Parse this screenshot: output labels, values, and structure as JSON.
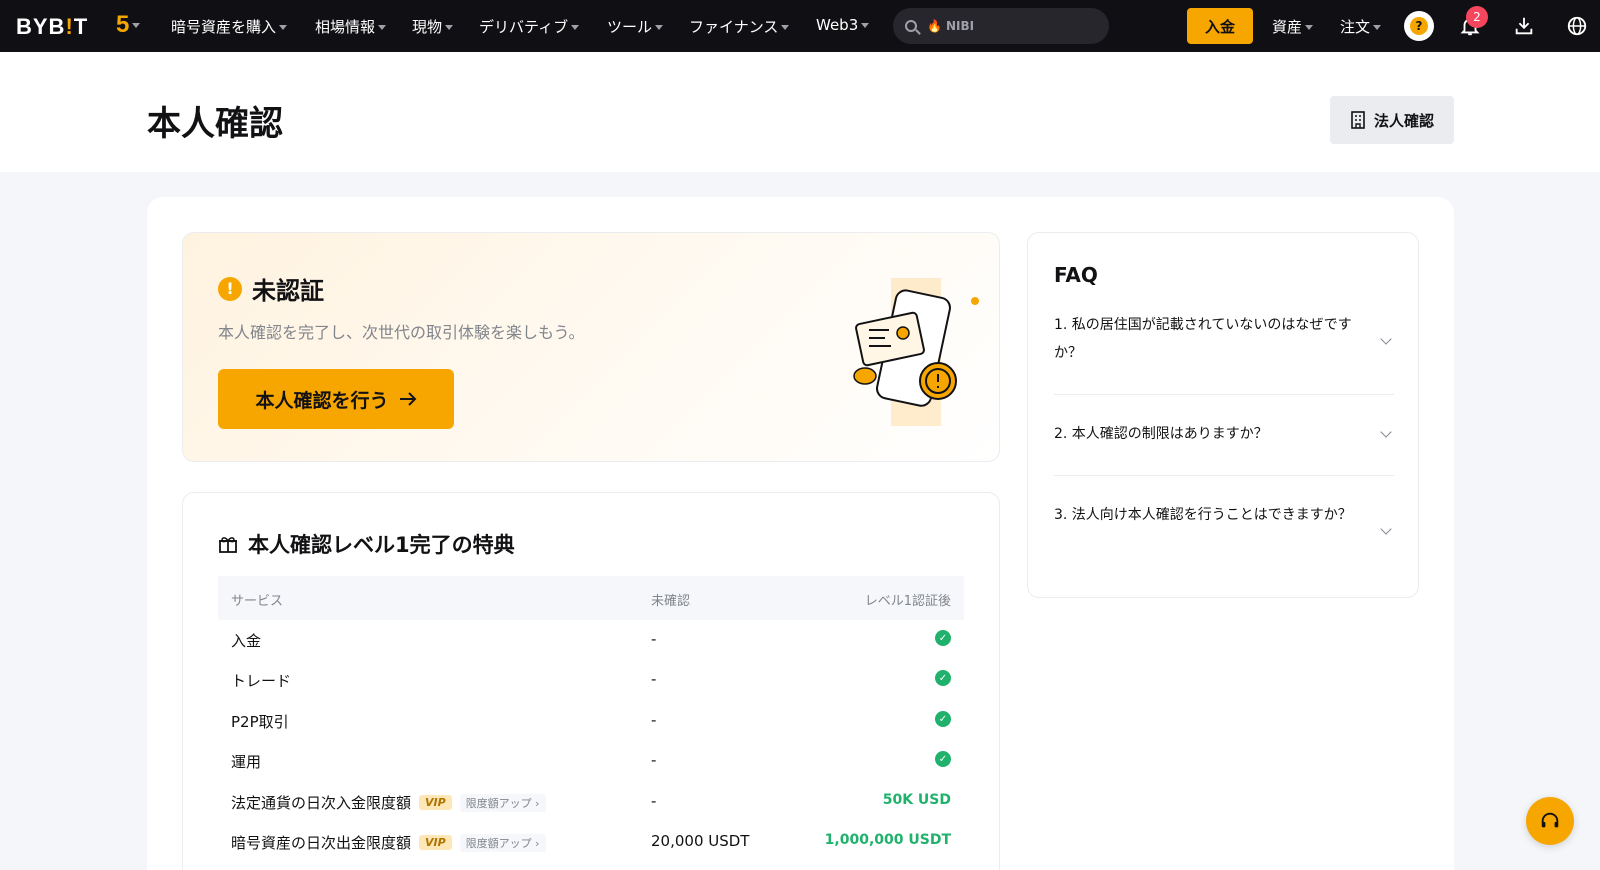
{
  "nav": {
    "logo_prefix": "BYB",
    "logo_i": "!",
    "logo_suffix": "T",
    "anniversary": "5",
    "items": [
      {
        "label": "暗号資産を購入"
      },
      {
        "label": "相場情報"
      },
      {
        "label": "現物"
      },
      {
        "label": "デリバティブ"
      },
      {
        "label": "ツール"
      },
      {
        "label": "ファイナンス"
      },
      {
        "label": "Web3"
      }
    ],
    "search_keyword": "NIBI",
    "deposit_label": "入金",
    "assets_label": "資産",
    "orders_label": "注文",
    "notification_count": "2",
    "avatar_glyph": "?"
  },
  "header": {
    "title": "本人確認",
    "corp_button": "法人確認"
  },
  "status": {
    "title": "未認証",
    "subtitle": "本人確認を完了し、次世代の取引体験を楽しもう。",
    "button": "本人確認を行う",
    "warn_glyph": "!"
  },
  "benefits": {
    "title": "本人確認レベル1完了の特典",
    "columns": {
      "service": "サービス",
      "unverified": "未確認",
      "level1": "レベル1認証後"
    },
    "vip_label": "VIP",
    "upgrade_label": "限度額アップ",
    "rows": [
      {
        "service": "入金",
        "unverified": "-",
        "level1": "",
        "check": true
      },
      {
        "service": "トレード",
        "unverified": "-",
        "level1": "",
        "check": true
      },
      {
        "service": "P2P取引",
        "unverified": "-",
        "level1": "",
        "check": true
      },
      {
        "service": "運用",
        "unverified": "-",
        "level1": "",
        "check": true
      },
      {
        "service": "法定通貨の日次入金限度額",
        "unverified": "-",
        "level1": "50K USD",
        "check": false,
        "vip": true
      },
      {
        "service": "暗号資産の日次出金限度額",
        "unverified": "20,000 USDT",
        "level1": "1,000,000 USDT",
        "check": false,
        "vip": true
      }
    ]
  },
  "faq": {
    "title": "FAQ",
    "items": [
      {
        "q": "1. 私の居住国が記載されていないのはなぜですか？"
      },
      {
        "q": "2. 本人確認の制限はありますか？"
      },
      {
        "q": "3. 法人向け本人確認を行うことはできますか？"
      }
    ]
  },
  "colors": {
    "accent": "#f7a600",
    "success": "#20b26c",
    "nav_bg": "#101014"
  }
}
